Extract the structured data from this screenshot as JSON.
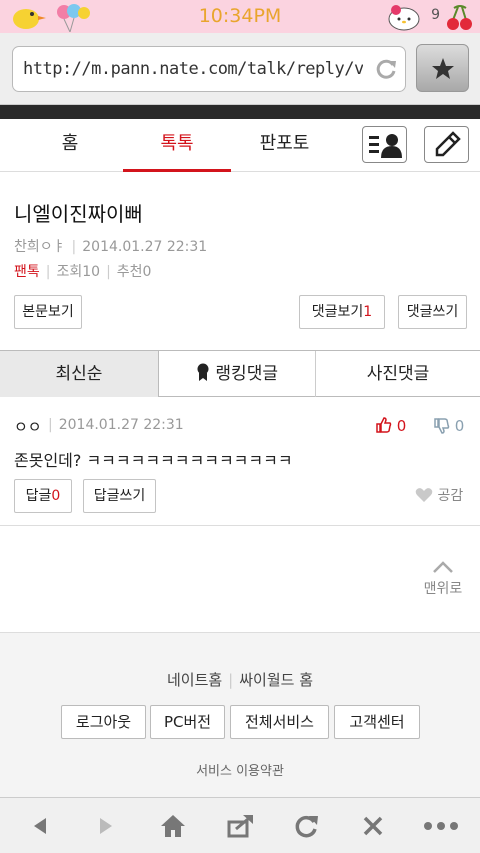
{
  "status_bar": {
    "time": "10:34PM",
    "battery": "9"
  },
  "browser": {
    "url": "http://m.pann.nate.com/talk/reply/view?pa",
    "icons": [
      "reload-icon",
      "star-icon"
    ]
  },
  "nav": {
    "tabs": [
      "홈",
      "톡톡",
      "판포토"
    ],
    "active_tab": "톡톡",
    "accent": "#d3141c"
  },
  "post": {
    "title": "니엘이진짜이뻐",
    "author": "찬희ㅇㅑ",
    "date": "2014.01.27 22:31",
    "category": "팬톡",
    "views": "조회10",
    "recommends": "추천0",
    "view_body_label": "본문보기",
    "view_comments_label": "댓글보기",
    "comment_count": "1",
    "write_comment_label": "댓글쓰기"
  },
  "sort_tabs": [
    "최신순",
    "랭킹댓글",
    "사진댓글"
  ],
  "comment": {
    "author": "ㅇㅇ",
    "date": "2014.01.27 22:31",
    "likes": "0",
    "dislikes": "0",
    "text": "존못인데? ㅋㅋㅋㅋㅋㅋㅋㅋㅋㅋㅋㅋㅋㅋ",
    "reply_label": "답글",
    "reply_count": "0",
    "write_reply_label": "답글쓰기",
    "empathy_label": "공감"
  },
  "to_top_label": "맨위로",
  "footer": {
    "link1": "네이트홈",
    "link2": "싸이월드 홈",
    "buttons": [
      "로그아웃",
      "PC버전",
      "전체서비스",
      "고객센터"
    ],
    "terms": "서비스 이용약관"
  },
  "bottom_bar_icons": [
    "back-icon",
    "forward-icon",
    "home-icon",
    "share-icon",
    "refresh-icon",
    "close-icon",
    "more-icon"
  ]
}
